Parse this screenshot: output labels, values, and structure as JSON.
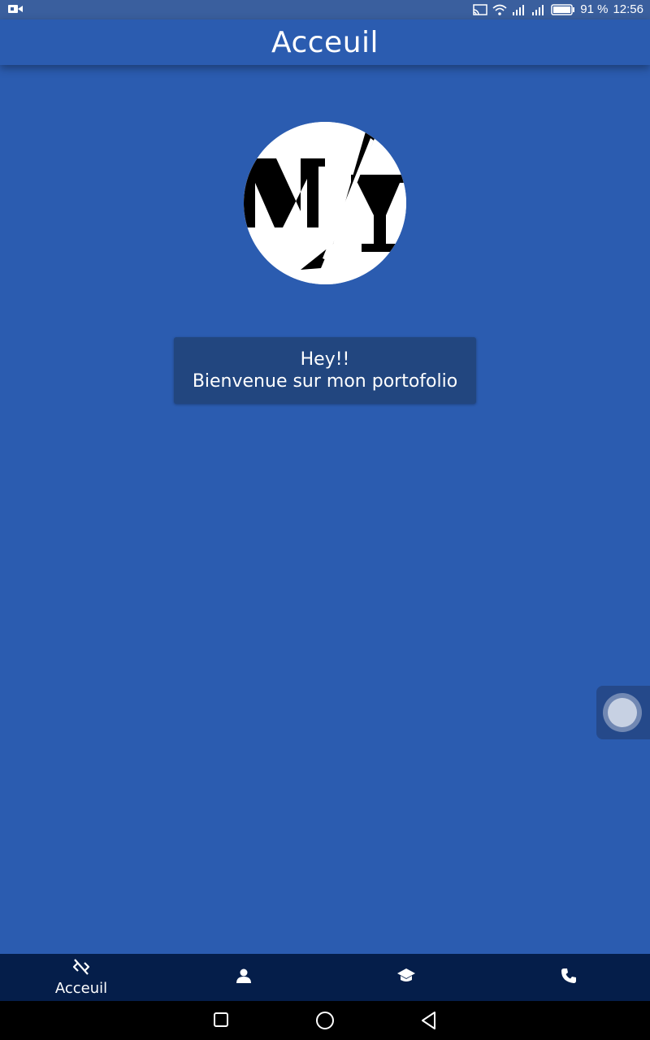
{
  "status_bar": {
    "battery_percent": "91 %",
    "time": "12:56",
    "icons": [
      "video-camera-icon",
      "cast-icon",
      "wifi-icon",
      "signal-icon",
      "signal-icon",
      "battery-icon"
    ]
  },
  "app_bar": {
    "title": "Acceuil"
  },
  "main": {
    "logo_icon": "my-logo",
    "welcome_line1": "Hey!!",
    "welcome_line2": "Bienvenue sur mon portofolio"
  },
  "bottom_nav": {
    "items": [
      {
        "icon": "code-off-icon",
        "label": "Acceuil",
        "active": true
      },
      {
        "icon": "person-icon",
        "label": "",
        "active": false
      },
      {
        "icon": "school-icon",
        "label": "",
        "active": false
      },
      {
        "icon": "phone-icon",
        "label": "",
        "active": false
      }
    ]
  },
  "system_nav": {
    "icons": [
      "recent-apps-icon",
      "home-icon",
      "back-icon"
    ]
  },
  "colors": {
    "primary": "#2b5cb0",
    "nav_background": "#051e4a",
    "card_background": "#22467f",
    "text": "#ffffff"
  }
}
